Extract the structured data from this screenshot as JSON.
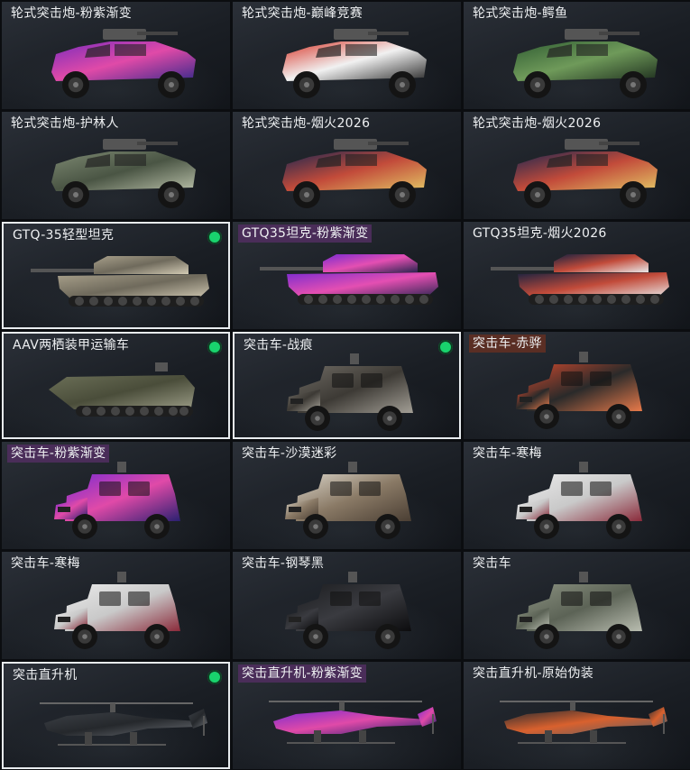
{
  "cards": [
    {
      "name": "轮式突击炮-粉紫渐变",
      "type": "wheeled",
      "colors": [
        "#7a2bbd",
        "#e04aa8",
        "#3a2a8a"
      ],
      "tag": "none",
      "selected": false,
      "equipped": false
    },
    {
      "name": "轮式突击炮-巅峰竞赛",
      "type": "wheeled",
      "colors": [
        "#d8372a",
        "#f1f1f1",
        "#2a2a2a"
      ],
      "tag": "none",
      "selected": false,
      "equipped": false
    },
    {
      "name": "轮式突击炮-鳄鱼",
      "type": "wheeled",
      "colors": [
        "#2f5c32",
        "#6f9a5a",
        "#1e2f1e"
      ],
      "tag": "none",
      "selected": false,
      "equipped": false
    },
    {
      "name": "轮式突击炮-护林人",
      "type": "wheeled",
      "colors": [
        "#7e8a73",
        "#4a5544",
        "#b8bfa8"
      ],
      "tag": "none",
      "selected": false,
      "equipped": false
    },
    {
      "name": "轮式突击炮-烟火2026",
      "type": "wheeled",
      "colors": [
        "#1b2550",
        "#c24b3a",
        "#e3c565"
      ],
      "tag": "none",
      "selected": false,
      "equipped": false
    },
    {
      "name": "轮式突击炮-烟火2026",
      "type": "wheeled",
      "colors": [
        "#1b2550",
        "#c24b3a",
        "#e3c565"
      ],
      "tag": "none",
      "selected": false,
      "equipped": false
    },
    {
      "name": "GTQ-35轻型坦克",
      "type": "tank",
      "colors": [
        "#a79f8a",
        "#6f6a5c",
        "#d2cab4"
      ],
      "tag": "none",
      "selected": true,
      "equipped": true
    },
    {
      "name": "GTQ35坦克-粉紫渐变",
      "type": "tank",
      "colors": [
        "#7c2bd0",
        "#e44fb2",
        "#2b2550"
      ],
      "tag": "purple",
      "selected": false,
      "equipped": false
    },
    {
      "name": "GTQ35坦克-烟火2026",
      "type": "tank",
      "colors": [
        "#1a2240",
        "#c24b3a",
        "#e8e8e8"
      ],
      "tag": "none",
      "selected": false,
      "equipped": false
    },
    {
      "name": "AAV两栖装甲运输车",
      "type": "aav",
      "colors": [
        "#6c7058",
        "#4a4d3a",
        "#9a9b85"
      ],
      "tag": "none",
      "selected": true,
      "equipped": true
    },
    {
      "name": "突击车-战痕",
      "type": "truck",
      "colors": [
        "#6e6a63",
        "#3d3a35",
        "#a39f96"
      ],
      "tag": "none",
      "selected": true,
      "equipped": true
    },
    {
      "name": "突击车-赤骅",
      "type": "truck",
      "colors": [
        "#c9482d",
        "#2a2a2a",
        "#e87a4a"
      ],
      "tag": "red",
      "selected": false,
      "equipped": false
    },
    {
      "name": "突击车-粉紫渐变",
      "type": "truck",
      "colors": [
        "#7c2bd0",
        "#e04aa8",
        "#2a2070"
      ],
      "tag": "purple",
      "selected": false,
      "equipped": false
    },
    {
      "name": "突击车-沙漠迷彩",
      "type": "truck",
      "colors": [
        "#d8d2c6",
        "#8a7a66",
        "#4a3e33"
      ],
      "tag": "none",
      "selected": false,
      "equipped": false
    },
    {
      "name": "突击车-寒梅",
      "type": "truck",
      "colors": [
        "#eaeaea",
        "#c9c9c9",
        "#8a2a3a"
      ],
      "tag": "none",
      "selected": false,
      "equipped": false
    },
    {
      "name": "突击车-寒梅",
      "type": "truck",
      "colors": [
        "#eaeaea",
        "#c9c9c9",
        "#8a2a3a"
      ],
      "tag": "none",
      "selected": false,
      "equipped": false
    },
    {
      "name": "突击车-钢琴黑",
      "type": "truck",
      "colors": [
        "#1c1d20",
        "#3a3b40",
        "#0c0c0e"
      ],
      "tag": "none",
      "selected": false,
      "equipped": false
    },
    {
      "name": "突击车",
      "type": "truck",
      "colors": [
        "#8a9180",
        "#5c6356",
        "#b9bdb0"
      ],
      "tag": "none",
      "selected": false,
      "equipped": false
    },
    {
      "name": "突击直升机",
      "type": "heli",
      "colors": [
        "#3c4046",
        "#25282c",
        "#6a6e74"
      ],
      "tag": "none",
      "selected": true,
      "equipped": true
    },
    {
      "name": "突击直升机-粉紫渐变",
      "type": "heli",
      "colors": [
        "#7c2bd0",
        "#e04aa8",
        "#2a2070"
      ],
      "tag": "purple",
      "selected": false,
      "equipped": false
    },
    {
      "name": "突击直升机-原始伪装",
      "type": "heli",
      "colors": [
        "#2a2c30",
        "#d9612e",
        "#5a5e64"
      ],
      "tag": "none",
      "selected": false,
      "equipped": false
    }
  ]
}
